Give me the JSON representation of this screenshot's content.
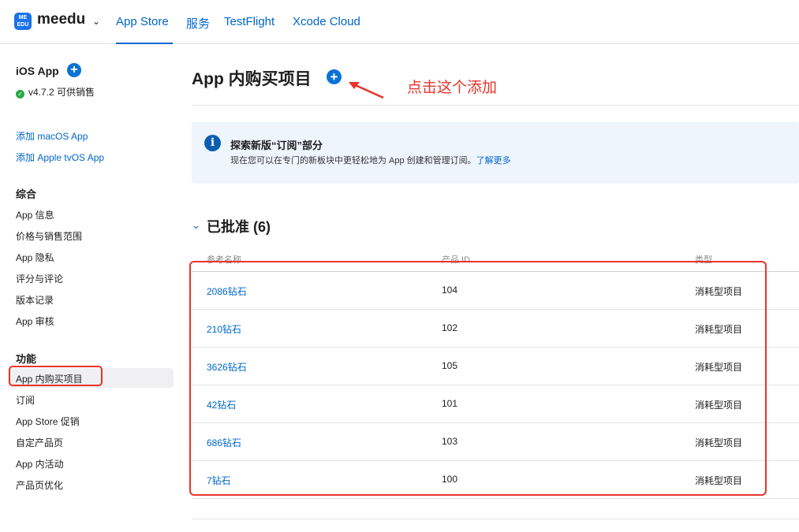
{
  "topnav": {
    "logo_text": "ME EDU",
    "app_name": "meedu",
    "tabs": [
      {
        "label": "App Store"
      },
      {
        "label": "服务"
      },
      {
        "label": "TestFlight"
      },
      {
        "label": "Xcode Cloud"
      }
    ]
  },
  "sidebar": {
    "app_title": "iOS App",
    "version_status": "v4.7.2 可供销售",
    "links": [
      "添加 macOS App",
      "添加 Apple tvOS App"
    ],
    "general_heading": "综合",
    "general_items": [
      "App 信息",
      "价格与销售范围",
      "App 隐私",
      "评分与评论",
      "版本记录",
      "App 审核"
    ],
    "features_heading": "功能",
    "features_items": [
      "App 内购买项目",
      "订阅",
      "App Store 促销",
      "自定产品页",
      "App 内活动",
      "产品页优化"
    ]
  },
  "main": {
    "title": "App 内购买项目",
    "annotation": "点击这个添加",
    "banner": {
      "title": "探索新版“订阅”部分",
      "text": "现在您可以在专门的新板块中更轻松地为 App 创建和管理订阅。",
      "link": "了解更多"
    },
    "section_title": "已批准 (6)",
    "columns": [
      "参考名称",
      "产品 ID",
      "类型"
    ],
    "rows": [
      {
        "name": "2086钻石",
        "pid": "104",
        "type": "消耗型项目"
      },
      {
        "name": "210钻石",
        "pid": "102",
        "type": "消耗型项目"
      },
      {
        "name": "3626钻石",
        "pid": "105",
        "type": "消耗型项目"
      },
      {
        "name": "42钻石",
        "pid": "101",
        "type": "消耗型项目"
      },
      {
        "name": "686钻石",
        "pid": "103",
        "type": "消耗型项目"
      },
      {
        "name": "7钻石",
        "pid": "100",
        "type": "消耗型项目"
      }
    ]
  },
  "colors": {
    "accent": "#0066cc",
    "annotation_red": "#e8342a",
    "status_green": "#28a745"
  }
}
